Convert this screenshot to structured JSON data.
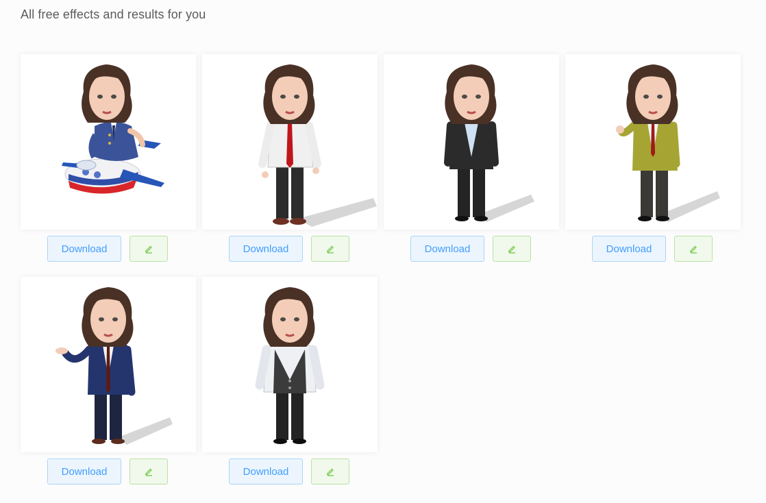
{
  "heading": "All free effects and results for you",
  "colors": {
    "download_text": "#409eff",
    "download_bg": "#ecf5fd",
    "download_border": "#a9d4f5",
    "edit_icon": "#67c23a",
    "edit_bg": "#f0f9eb",
    "edit_border": "#b9e2a4"
  },
  "cards": [
    {
      "effect": "pilot-on-airplane",
      "download_label": "Download",
      "edit_icon": "pencil-icon"
    },
    {
      "effect": "white-shirt-red-tie",
      "download_label": "Download",
      "edit_icon": "pencil-icon"
    },
    {
      "effect": "black-suit-blue-shirt",
      "download_label": "Download",
      "edit_icon": "pencil-icon"
    },
    {
      "effect": "olive-blazer-red-tie",
      "download_label": "Download",
      "edit_icon": "pencil-icon"
    },
    {
      "effect": "navy-suit-waving",
      "download_label": "Download",
      "edit_icon": "pencil-icon"
    },
    {
      "effect": "black-vest-white-shirt",
      "download_label": "Download",
      "edit_icon": "pencil-icon"
    }
  ]
}
